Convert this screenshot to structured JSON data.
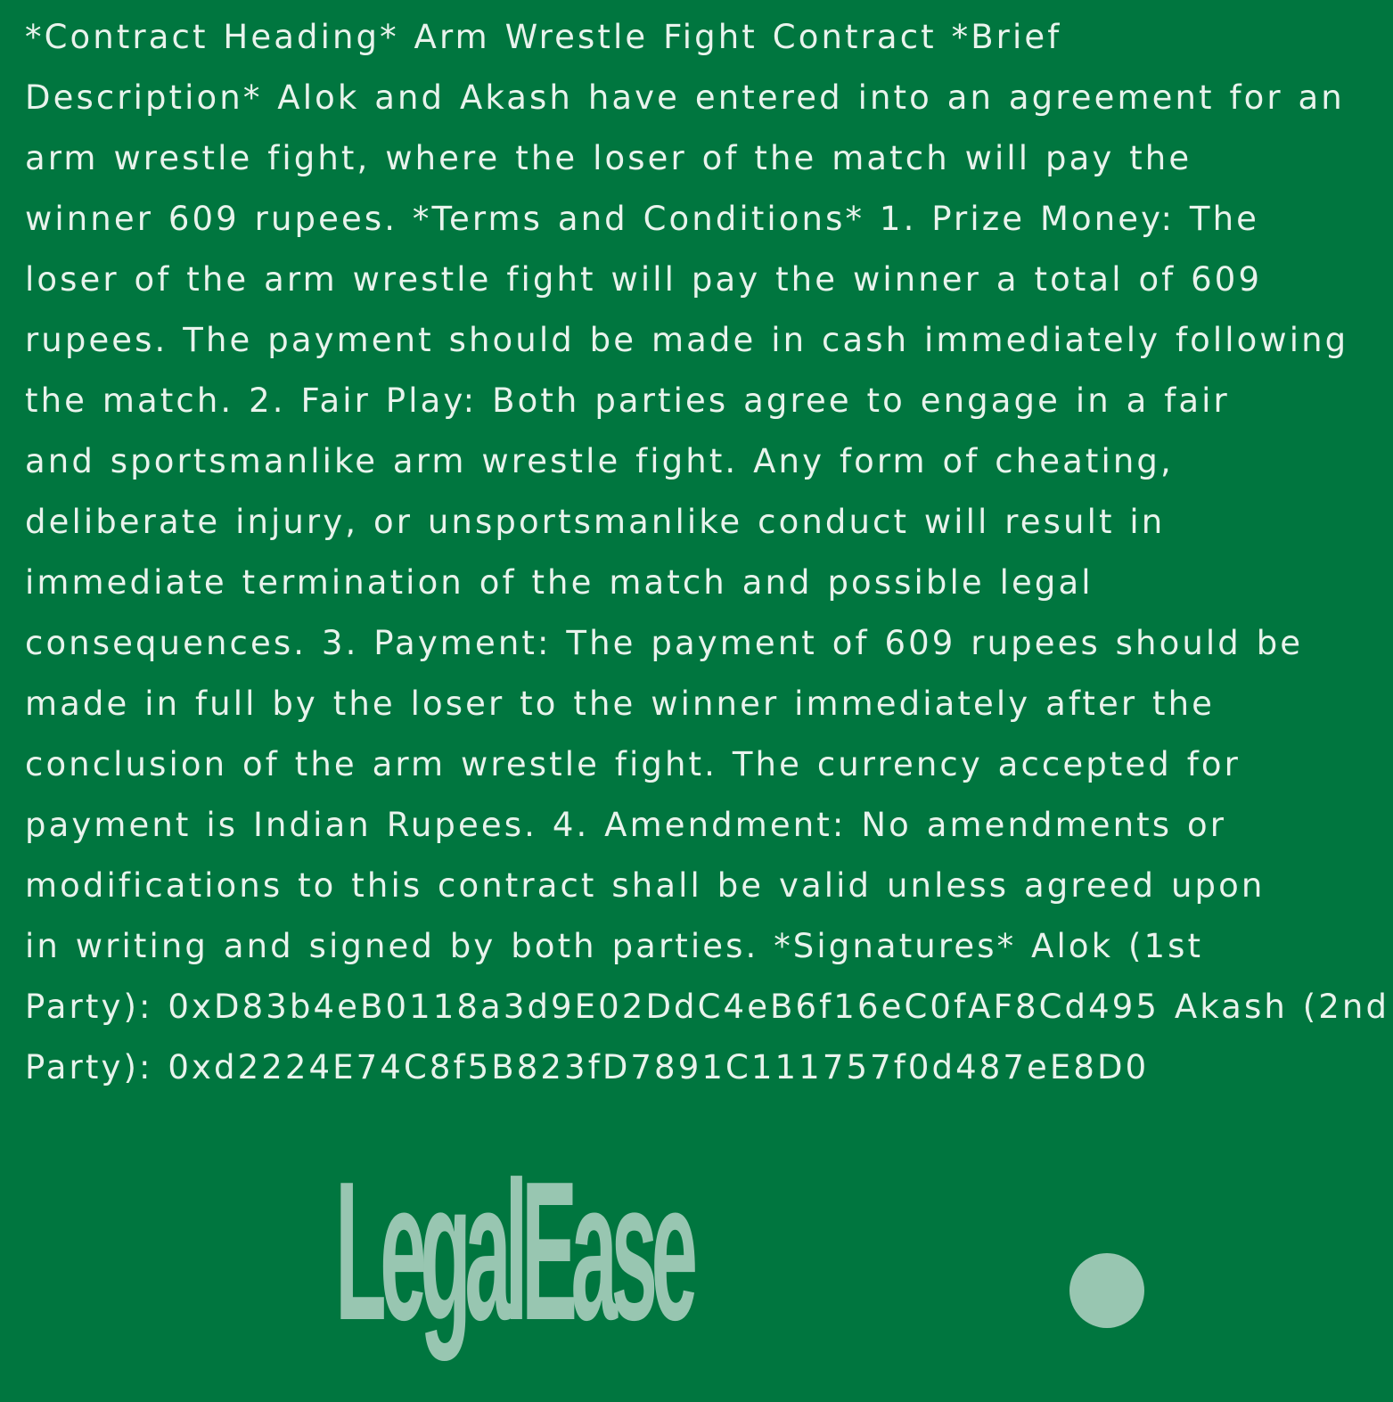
{
  "contract": {
    "lines": [
      "*Contract Heading* Arm Wrestle Fight Contract  *Brief",
      "Description* Alok and Akash have entered into an agreement for an",
      "arm wrestle fight, where the loser of the match will pay the",
      "winner 609 rupees.  *Terms and Conditions* 1. Prize Money: The",
      "loser of the arm wrestle fight will pay the winner a total of 609",
      "rupees. The payment should be made in cash immediately following",
      "the match.  2. Fair Play: Both parties agree to engage in a fair",
      "and sportsmanlike arm wrestle fight. Any form of cheating,",
      "deliberate injury, or unsportsmanlike conduct will result in",
      "immediate termination of the match and possible legal",
      "consequences.  3. Payment: The payment of 609 rupees should be",
      "made in full by the loser to the winner immediately after the",
      "conclusion of the arm wrestle fight. The currency accepted for",
      "payment is Indian Rupees.  4. Amendment: No amendments or",
      "modifications to this contract shall be valid unless agreed upon",
      "in writing and signed by both parties.  *Signatures* Alok (1st",
      "Party): 0xD83b4eB0118a3d9E02DdC4eB6f16eC0fAF8Cd495 Akash (2nd",
      "Party): 0xd2224E74C8f5B823fD7891C111757f0d487eE8D0"
    ]
  },
  "logo": {
    "text": "LegalEase",
    "color": "#98c6b1"
  },
  "colors": {
    "background": "#00763f",
    "text": "#e8f3ec"
  }
}
